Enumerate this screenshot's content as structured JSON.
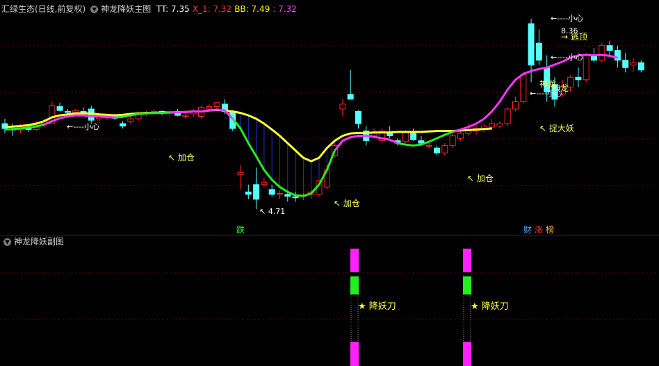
{
  "main_panel": {
    "stock_name": "汇绿生态(日线,前复权)",
    "indicator_name": "神龙降妖主图",
    "values": [
      {
        "label": "TT: 7.35",
        "color": "#ffffff"
      },
      {
        "label": "X_1: 7.32",
        "color": "#ff3333"
      },
      {
        "label": "BB: 7.49",
        "color": "#ffff00"
      },
      {
        "label": ": 7.32",
        "color": "#ff44ff"
      }
    ]
  },
  "sub_panel": {
    "indicator_name": "神龙降妖副图"
  },
  "colors": {
    "up": "#ff2222",
    "down": "#55ffff",
    "ma_yellow": "#ffff33",
    "ma_green": "#22ee22",
    "ma_magenta": "#ff33ff",
    "grid": "#8b0000"
  },
  "chart_data": [
    {
      "type": "candlestick",
      "title": "神龙降妖主图",
      "ylim": [
        4.4,
        8.7
      ],
      "candles": [
        [
          6.45,
          6.55,
          6.25,
          6.35
        ],
        [
          6.35,
          6.45,
          6.2,
          6.32
        ],
        [
          6.32,
          6.45,
          6.25,
          6.35
        ],
        [
          6.35,
          6.42,
          6.28,
          6.33
        ],
        [
          6.33,
          6.5,
          6.3,
          6.42
        ],
        [
          6.45,
          6.55,
          6.35,
          6.5
        ],
        [
          6.45,
          6.9,
          6.45,
          6.82
        ],
        [
          6.8,
          6.88,
          6.7,
          6.72
        ],
        [
          6.7,
          6.75,
          6.6,
          6.68
        ],
        [
          6.68,
          6.75,
          6.65,
          6.72
        ],
        [
          6.7,
          6.78,
          6.62,
          6.66
        ],
        [
          6.75,
          6.82,
          6.45,
          6.52
        ],
        [
          6.55,
          6.65,
          6.45,
          6.6
        ],
        [
          6.6,
          6.65,
          6.52,
          6.6
        ],
        [
          6.58,
          6.65,
          6.52,
          6.56
        ],
        [
          6.45,
          6.5,
          6.35,
          6.4
        ],
        [
          6.5,
          6.6,
          6.45,
          6.55
        ],
        [
          6.55,
          6.7,
          6.5,
          6.65
        ],
        [
          6.65,
          6.72,
          6.6,
          6.68
        ],
        [
          6.68,
          6.75,
          6.62,
          6.7
        ],
        [
          6.7,
          6.72,
          6.62,
          6.66
        ],
        [
          6.66,
          6.72,
          6.6,
          6.68
        ],
        [
          6.7,
          6.75,
          6.6,
          6.62
        ],
        [
          6.6,
          6.7,
          6.55,
          6.62
        ],
        [
          6.65,
          6.75,
          6.58,
          6.7
        ],
        [
          6.6,
          6.82,
          6.55,
          6.78
        ],
        [
          6.75,
          6.85,
          6.7,
          6.8
        ],
        [
          6.8,
          6.9,
          6.75,
          6.88
        ],
        [
          6.85,
          6.95,
          6.65,
          6.7
        ],
        [
          6.7,
          6.72,
          6.3,
          6.35
        ],
        [
          5.4,
          5.6,
          5.1,
          5.45
        ],
        [
          5.05,
          5.2,
          4.9,
          5.0
        ],
        [
          5.2,
          5.55,
          4.7,
          4.9
        ],
        [
          5.2,
          5.35,
          5.15,
          5.25
        ],
        [
          5.1,
          5.2,
          4.95,
          5.0
        ],
        [
          5.0,
          5.08,
          4.9,
          5.02
        ],
        [
          5.0,
          5.08,
          4.85,
          4.96
        ],
        [
          4.95,
          5.05,
          4.85,
          4.93
        ],
        [
          4.95,
          5.02,
          4.88,
          4.98
        ],
        [
          5.0,
          5.1,
          4.9,
          5.05
        ],
        [
          5.0,
          5.3,
          4.95,
          5.28
        ],
        [
          5.15,
          5.6,
          5.1,
          5.5
        ],
        [
          5.8,
          6.05,
          5.75,
          6.0
        ],
        [
          6.75,
          6.95,
          6.6,
          6.85
        ],
        [
          7.05,
          7.55,
          7.0,
          6.95
        ],
        [
          6.7,
          6.72,
          6.35,
          6.45
        ],
        [
          6.3,
          6.4,
          6.0,
          6.1
        ],
        [
          6.2,
          6.35,
          6.15,
          6.25
        ],
        [
          6.1,
          6.35,
          6.05,
          6.3
        ],
        [
          6.25,
          6.4,
          6.15,
          6.2
        ],
        [
          6.1,
          6.15,
          6.0,
          6.05
        ],
        [
          6.08,
          6.32,
          6.05,
          6.28
        ],
        [
          6.25,
          6.35,
          6.1,
          6.12
        ],
        [
          6.1,
          6.2,
          6.0,
          6.05
        ],
        [
          6.0,
          6.1,
          5.95,
          6.0
        ],
        [
          5.95,
          6.0,
          5.8,
          5.85
        ],
        [
          5.85,
          6.05,
          5.8,
          6.0
        ],
        [
          6.0,
          6.25,
          5.95,
          6.2
        ],
        [
          6.15,
          6.3,
          6.1,
          6.25
        ],
        [
          6.25,
          6.45,
          6.2,
          6.3
        ],
        [
          6.3,
          6.42,
          6.22,
          6.35
        ],
        [
          6.35,
          6.45,
          6.28,
          6.4
        ],
        [
          6.38,
          6.55,
          6.32,
          6.45
        ],
        [
          6.4,
          6.5,
          6.35,
          6.45
        ],
        [
          6.45,
          6.78,
          6.4,
          6.75
        ],
        [
          6.75,
          7.0,
          6.7,
          6.9
        ],
        [
          6.9,
          7.5,
          6.85,
          7.45
        ],
        [
          8.5,
          8.6,
          7.3,
          7.65
        ],
        [
          8.1,
          8.38,
          7.65,
          7.75
        ],
        [
          7.6,
          7.85,
          6.9,
          7.1
        ],
        [
          7.25,
          7.4,
          6.8,
          6.95
        ],
        [
          7.05,
          7.35,
          7.0,
          7.2
        ],
        [
          7.2,
          7.45,
          7.1,
          7.4
        ],
        [
          7.4,
          7.6,
          7.2,
          7.35
        ],
        [
          7.35,
          7.9,
          7.3,
          7.85
        ],
        [
          7.85,
          8.0,
          7.7,
          7.75
        ],
        [
          7.75,
          8.1,
          7.7,
          8.05
        ],
        [
          8.05,
          8.15,
          7.85,
          7.95
        ],
        [
          7.95,
          8.05,
          7.6,
          7.75
        ],
        [
          7.75,
          7.9,
          7.5,
          7.6
        ],
        [
          7.65,
          7.8,
          7.5,
          7.7
        ],
        [
          7.7,
          7.75,
          7.5,
          7.55
        ]
      ],
      "series": [
        {
          "values": [
            6.38,
            6.39,
            6.4,
            6.42,
            6.45,
            6.5,
            6.58,
            6.62,
            6.64,
            6.66,
            6.66,
            6.66,
            6.64,
            6.63,
            6.62,
            6.63,
            6.65,
            6.66,
            6.67,
            6.67,
            6.68,
            6.68,
            6.68,
            6.69,
            6.7,
            6.7,
            6.72,
            6.73,
            6.72,
            6.7,
            6.67,
            6.62,
            6.55,
            6.45,
            6.33,
            6.2,
            6.05,
            5.9,
            5.75,
            5.68,
            5.75,
            5.95,
            6.1,
            6.2,
            6.25,
            6.26,
            6.26,
            6.27,
            6.27,
            6.27,
            6.28,
            6.28,
            6.28,
            6.28,
            6.29,
            6.3,
            6.3,
            6.3,
            6.31,
            6.32,
            6.33,
            6.34,
            6.35
          ]
        },
        {
          "values": [
            6.33,
            6.34,
            6.35,
            6.37,
            6.39,
            6.43,
            6.5,
            6.56,
            6.6,
            6.62,
            6.62,
            6.6,
            6.6,
            6.58,
            6.58,
            6.59,
            6.62,
            6.65,
            6.66,
            6.67,
            6.67,
            6.68,
            6.68,
            6.69,
            6.7,
            6.7,
            6.72,
            6.74,
            6.72,
            6.55,
            6.35,
            6.05,
            5.78,
            5.5,
            5.3,
            5.15,
            5.05,
            4.98,
            4.97,
            5.02,
            5.2,
            5.5,
            5.9,
            6.1,
            6.17,
            6.2,
            6.2,
            6.18,
            6.15,
            6.12,
            6.05,
            6.02,
            6.0,
            6.02,
            6.08,
            6.15,
            6.22,
            6.28,
            6.33,
            6.38,
            6.45,
            6.55,
            6.7,
            6.9,
            7.15,
            7.35,
            7.47,
            7.53,
            7.57,
            7.6,
            7.66,
            7.72,
            7.8,
            7.85,
            7.86,
            7.85,
            7.86,
            7.84,
            7.8
          ]
        }
      ]
    },
    {
      "type": "bar",
      "title": "神龙降妖副图",
      "note": "降妖刀"
    }
  ],
  "annotations": {
    "caution_1": "←----小心",
    "caution_2": "←----小心",
    "caution_3": "←----小心",
    "caution_4": "←----小心",
    "add_1": "↖ 加仓",
    "add_2": "↖ 加仓",
    "add_3": "↖ 加仓",
    "low": "↖ 4.71",
    "high": "8.36",
    "escape": "→ 逃顶",
    "catch": "↖ 捉大妖",
    "shenlong": "神龙",
    "rise_flag": "神龙",
    "fall_tag": "跌",
    "tag_cai": "财",
    "tag_zhang": "涨",
    "tag_bang": "榜",
    "sword_1": "★ 降妖刀",
    "sword_2": "★ 降妖刀"
  }
}
